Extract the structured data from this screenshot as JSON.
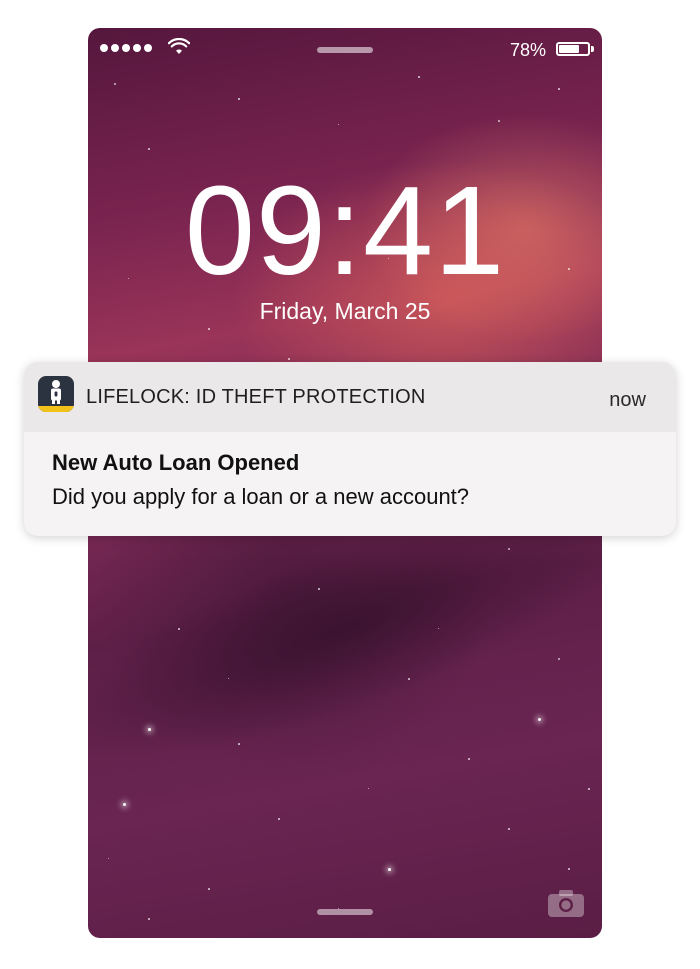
{
  "status_bar": {
    "signal_icon": "signal-dots-icon",
    "wifi_icon": "wifi-icon",
    "battery_text": "78%",
    "battery_level": 0.78,
    "battery_icon": "battery-icon"
  },
  "lock_screen": {
    "time": "09:41",
    "date": "Friday, March 25",
    "camera_icon": "camera-icon"
  },
  "notification": {
    "app_icon": "lifelock-app-icon",
    "app_name": "LIFELOCK: ID THEFT PROTECTION",
    "time": "now",
    "title": "New Auto Loan Opened",
    "body": "Did you apply for a loan or a new account?"
  },
  "colors": {
    "app_icon_bg": "#2b3340",
    "app_icon_accent": "#f2c21a",
    "wallpaper_primary": "#7a2450"
  }
}
